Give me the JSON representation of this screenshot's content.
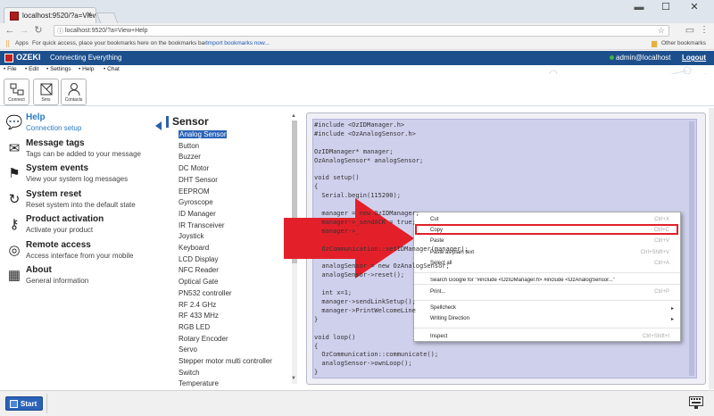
{
  "browser": {
    "tab_title": "localhost:9520/?a=View+Help",
    "url": "localhost:9520/?a=View+Help",
    "bookmarks_prefix": "Apps",
    "bookmarks_hint": "For quick access, place your bookmarks here on the bookmarks bar.",
    "bookmarks_link": "Import bookmarks now...",
    "other_bookmarks": "Other bookmarks"
  },
  "app": {
    "brand": "OZEKI",
    "tagline": "Connecting Everything",
    "user": "admin@localhost",
    "logout": "Logout",
    "menu": [
      "File",
      "Edit",
      "Settings",
      "Help",
      "Chat"
    ],
    "toolbar": [
      "Connect",
      "Sms",
      "Contacts"
    ]
  },
  "left_panel": [
    {
      "title": "Help",
      "subtitle": "Connection setup",
      "icon": "chat-bubble-icon",
      "active": true
    },
    {
      "title": "Message tags",
      "subtitle": "Tags can be added to your message",
      "icon": "envelope-icon",
      "active": false
    },
    {
      "title": "System events",
      "subtitle": "View your system log messages",
      "icon": "flag-icon",
      "active": false
    },
    {
      "title": "System reset",
      "subtitle": "Reset system into the default state",
      "icon": "reset-icon",
      "active": false
    },
    {
      "title": "Product activation",
      "subtitle": "Activate your product",
      "icon": "key-icon",
      "active": false
    },
    {
      "title": "Remote access",
      "subtitle": "Access interface from your mobile",
      "icon": "globe-icon",
      "active": false
    },
    {
      "title": "About",
      "subtitle": "General information",
      "icon": "grid-icon",
      "active": false
    }
  ],
  "sensor_panel": {
    "heading": "Sensor",
    "items": [
      "Analog Sensor",
      "Button",
      "Buzzer",
      "DC Motor",
      "DHT Sensor",
      "EEPROM",
      "Gyroscope",
      "ID Manager",
      "IR Transceiver",
      "Joystick",
      "Keyboard",
      "LCD Display",
      "NFC Reader",
      "Optical Gate",
      "PN532 controller",
      "RF 2.4 GHz",
      "RF 433 MHz",
      "RGB LED",
      "Rotary Encoder",
      "Servo",
      "Stepper motor multi controller",
      "Switch",
      "Temperature"
    ],
    "selected_index": 0
  },
  "code_lines": [
    "#include <OzIDManager.h>",
    "#include <OzAnalogSensor.h>",
    "",
    "OzIDManager* manager;",
    "OzAnalogSensor* analogSensor;",
    "",
    "void setup()",
    "{",
    "  Serial.begin(115200);",
    "",
    "  manager = new OzIDManager;",
    "  manager->_sendACK = true;",
    "  manager->_",
    "",
    "  OzCommunication::setIDManager(manager);",
    "",
    "  analogSensor = new OzAnalogSensor;",
    "  analogSensor->reset();",
    "",
    "  int x=1;",
    "  manager->sendLinkSetup();",
    "  manager->PrintWelcomeLine",
    "}",
    "",
    "void loop()",
    "{",
    "  OzCommunication::communicate();",
    "  analogSensor->ownLoop();",
    "}"
  ],
  "context_menu": [
    {
      "label": "Cut",
      "shortcut": "Ctrl+X"
    },
    {
      "label": "Copy",
      "shortcut": "Ctrl+C",
      "highlighted": true
    },
    {
      "label": "Paste",
      "shortcut": "Ctrl+V"
    },
    {
      "label": "Paste as plain text",
      "shortcut": "Ctrl+Shift+V"
    },
    {
      "label": "Select all",
      "shortcut": "Ctrl+A"
    },
    {
      "label": "Search Google for \"#include <OzIDManager.h> #include <OzAnalogSensor...\"",
      "shortcut": ""
    },
    {
      "label": "Print...",
      "shortcut": "Ctrl+P"
    },
    {
      "label": "Spellcheck",
      "shortcut": ""
    },
    {
      "label": "Writing Direction",
      "shortcut": ""
    },
    {
      "label": "Inspect",
      "shortcut": "Ctrl+Shift+I"
    }
  ],
  "taskbar": {
    "start": "Start"
  },
  "colors": {
    "header": "#1d4f8c",
    "accent": "#2a62b8",
    "highlight": "#e0202a",
    "arrow": "#e3202a"
  }
}
